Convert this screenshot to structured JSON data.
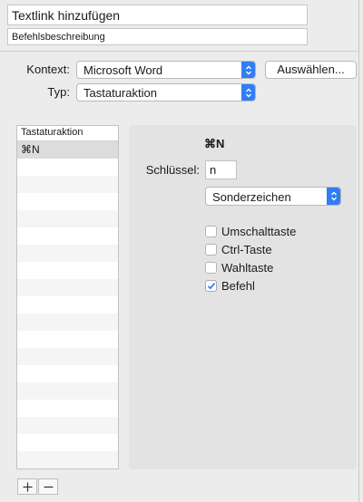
{
  "header": {
    "title_value": "Textlink hinzufügen",
    "description_value": "Befehlsbeschreibung"
  },
  "form": {
    "context_label": "Kontext:",
    "context_value": "Microsoft Word",
    "choose_button": "Auswählen...",
    "type_label": "Typ:",
    "type_value": "Tastaturaktion"
  },
  "list": {
    "header": "Tastaturaktion",
    "items": [
      "⌘N"
    ]
  },
  "detail": {
    "shortcut": "⌘N",
    "key_label": "Schlüssel:",
    "key_value": "n",
    "key_type_value": "Sonderzeichen",
    "modifiers": [
      {
        "label": "Umschalttaste",
        "checked": false
      },
      {
        "label": "Ctrl-Taste",
        "checked": false
      },
      {
        "label": "Wahltaste",
        "checked": false
      },
      {
        "label": "Befehl",
        "checked": true
      }
    ]
  },
  "colors": {
    "accent": "#2f7ef6",
    "panel_bg": "#e3e3e3",
    "window_bg": "#ececec"
  },
  "icons": {
    "add": "plus-icon",
    "remove": "minus-icon",
    "popup": "up-down-chevron-icon",
    "check": "checkmark-icon"
  }
}
